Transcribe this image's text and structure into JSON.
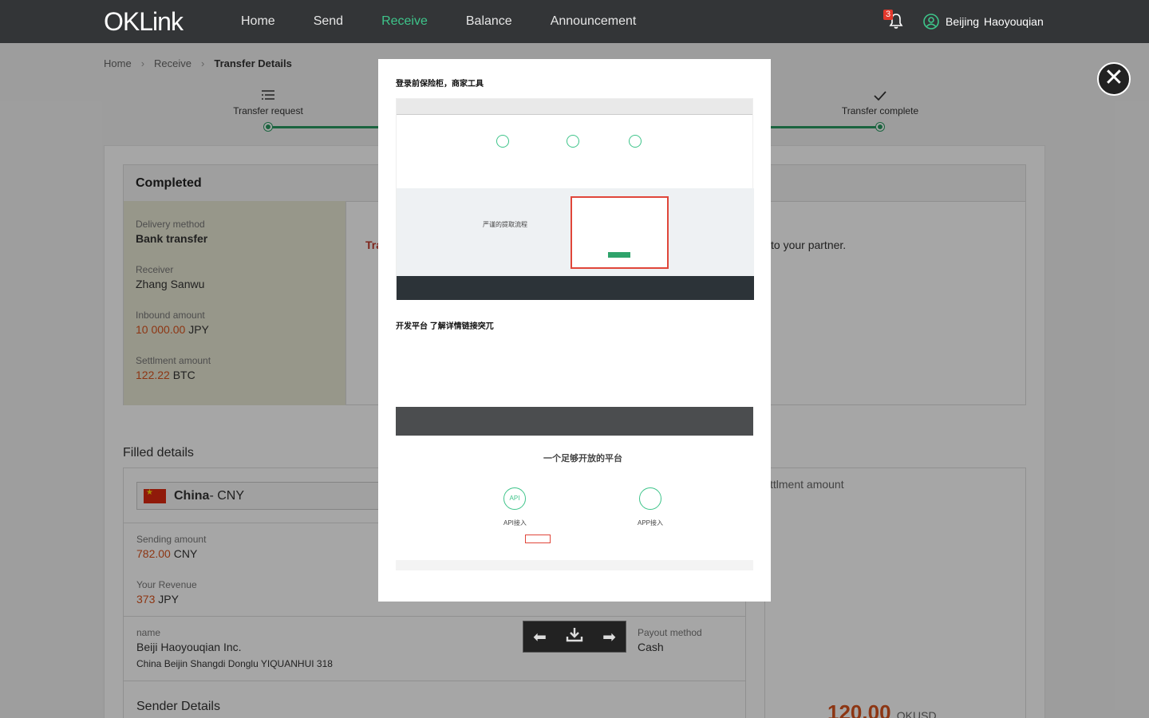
{
  "nav": {
    "logo_ok": "OK",
    "logo_link": "Link",
    "items": [
      "Home",
      "Send",
      "Receive",
      "Balance",
      "Announcement"
    ],
    "active": "Receive",
    "notification_count": "3",
    "user_city": "Beijing",
    "user_name": "Haoyouqian"
  },
  "breadcrumb": [
    "Home",
    "Receive",
    "Transfer Details"
  ],
  "steps": {
    "first": "Transfer request",
    "last": "Transfer complete"
  },
  "status": {
    "title": "Completed",
    "delivery_label": "Delivery method",
    "delivery_value": "Bank transfer",
    "receiver_label": "Receiver",
    "receiver_value": "Zhang Sanwu",
    "inbound_label": "Inbound amount",
    "inbound_value": "10 000.00",
    "inbound_currency": "JPY",
    "settlement_label": "Settlment amount",
    "settlement_value": "122.22",
    "settlement_currency": "BTC",
    "partial_left": "Tra",
    "partial_right": "to your partner."
  },
  "filled": {
    "title": "Filled details",
    "country": "China",
    "country_currency": " - CNY",
    "sending_label": "Sending amount",
    "sending_value": "782.00",
    "sending_currency": "CNY",
    "revenue_label": "Your Revenue",
    "revenue_value": "373",
    "revenue_currency": "JPY",
    "name_label": "name",
    "name_value": "Beiji Haoyouqian Inc.",
    "address": "China  Beijin  Shangdi Donglu YIQUANHUI 318",
    "payout_label": "Payout method",
    "payout_value": "Cash",
    "sender_title": "Sender Details",
    "right_label": "ttlment amount",
    "big_amount": "120.00",
    "big_currency": "OKUSD"
  },
  "viewer": {
    "text1": "登录前保险柜，商家工具",
    "text2": "开发平台 了解详情链接突兀",
    "shot1_heading": "严谨的提取流程",
    "shot2_heading": "一个足够开放的平台",
    "api_label": "API接入",
    "app_label": "APP接入"
  },
  "toolbar": {
    "prev_icon": "arrow-left-icon",
    "download_icon": "download-icon",
    "next_icon": "arrow-right-icon"
  }
}
